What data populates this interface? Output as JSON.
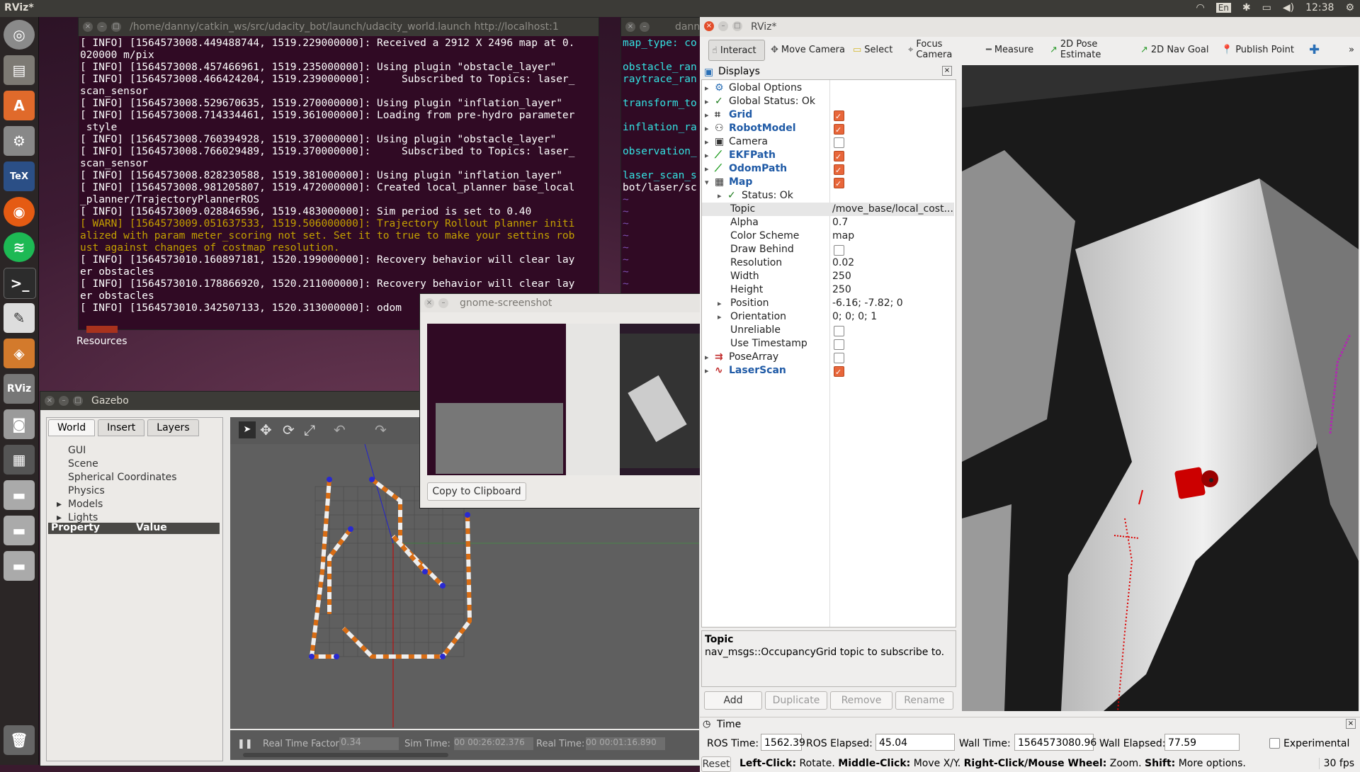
{
  "topbar": {
    "title": "RViz*",
    "keyboard": "En",
    "clock": "12:38"
  },
  "launcher": {
    "items": [
      "ubuntu-dash",
      "files",
      "software-center",
      "system-settings",
      "texmaker",
      "firefox",
      "spotify",
      "terminal",
      "text-editor",
      "virtualbox",
      "rviz",
      "screenshot",
      "workspaces",
      "drive-1",
      "drive-2",
      "drive-3",
      "trash"
    ]
  },
  "terminal1": {
    "title": "/home/danny/catkin_ws/src/udacity_bot/launch/udacity_world.launch http://localhost:1",
    "lines": [
      {
        "text": "[ INFO] [1564573008.449488744, 1519.229000000]: Received a 2912 X 2496 map at 0.",
        "cls": ""
      },
      {
        "text": "020000 m/pix",
        "cls": ""
      },
      {
        "text": "[ INFO] [1564573008.457466961, 1519.235000000]: Using plugin \"obstacle_layer\"",
        "cls": ""
      },
      {
        "text": "[ INFO] [1564573008.466424204, 1519.239000000]:     Subscribed to Topics: laser_",
        "cls": ""
      },
      {
        "text": "scan_sensor",
        "cls": ""
      },
      {
        "text": "[ INFO] [1564573008.529670635, 1519.270000000]: Using plugin \"inflation_layer\"",
        "cls": ""
      },
      {
        "text": "[ INFO] [1564573008.714334461, 1519.361000000]: Loading from pre-hydro parameter",
        "cls": ""
      },
      {
        "text": " style",
        "cls": ""
      },
      {
        "text": "[ INFO] [1564573008.760394928, 1519.370000000]: Using plugin \"obstacle_layer\"",
        "cls": ""
      },
      {
        "text": "[ INFO] [1564573008.766029489, 1519.370000000]:     Subscribed to Topics: laser_",
        "cls": ""
      },
      {
        "text": "scan_sensor",
        "cls": ""
      },
      {
        "text": "[ INFO] [1564573008.828230588, 1519.381000000]: Using plugin \"inflation_layer\"",
        "cls": ""
      },
      {
        "text": "[ INFO] [1564573008.981205807, 1519.472000000]: Created local_planner base_local",
        "cls": ""
      },
      {
        "text": "_planner/TrajectoryPlannerROS",
        "cls": ""
      },
      {
        "text": "[ INFO] [1564573009.028846596, 1519.483000000]: Sim period is set to 0.40",
        "cls": ""
      },
      {
        "text": "[ WARN] [1564573009.051637533, 1519.506000000]: Trajectory Rollout planner initi",
        "cls": "warn"
      },
      {
        "text": "alized with param meter_scoring not set. Set it to true to make your settins rob",
        "cls": "warn"
      },
      {
        "text": "ust against changes of costmap resolution.",
        "cls": "warn"
      },
      {
        "text": "[ INFO] [1564573010.160897181, 1520.199000000]: Recovery behavior will clear lay",
        "cls": ""
      },
      {
        "text": "er obstacles",
        "cls": ""
      },
      {
        "text": "[ INFO] [1564573010.178866920, 1520.211000000]: Recovery behavior will clear lay",
        "cls": ""
      },
      {
        "text": "er obstacles",
        "cls": ""
      },
      {
        "text": "[ INFO] [1564573010.342507133, 1520.313000000]: odom",
        "cls": ""
      }
    ]
  },
  "terminal2": {
    "title": "dann",
    "lines": [
      {
        "text": "map_type: co",
        "cls": "cyan"
      },
      {
        "text": "",
        "cls": ""
      },
      {
        "text": "obstacle_ran",
        "cls": "cyan"
      },
      {
        "text": "raytrace_ran",
        "cls": "cyan"
      },
      {
        "text": "",
        "cls": ""
      },
      {
        "text": "transform_to",
        "cls": "cyan"
      },
      {
        "text": "",
        "cls": ""
      },
      {
        "text": "inflation_ra",
        "cls": "cyan"
      },
      {
        "text": "",
        "cls": ""
      },
      {
        "text": "observation_",
        "cls": "cyan"
      },
      {
        "text": "",
        "cls": ""
      },
      {
        "text": "laser_scan_s",
        "cls": "cyan"
      },
      {
        "text": "bot/laser/sc",
        "cls": ""
      },
      {
        "text": "~",
        "cls": "purple"
      },
      {
        "text": "~",
        "cls": "purple"
      },
      {
        "text": "~",
        "cls": "purple"
      },
      {
        "text": "~",
        "cls": "purple"
      },
      {
        "text": "~",
        "cls": "purple"
      },
      {
        "text": "~",
        "cls": "purple"
      },
      {
        "text": "~",
        "cls": "purple"
      },
      {
        "text": "~",
        "cls": "purple"
      },
      {
        "text": "~",
        "cls": "purple"
      }
    ]
  },
  "desktop": {
    "resources_label": "Resources"
  },
  "screenshot_dialog": {
    "title": "gnome-screenshot",
    "copy_button": "Copy to Clipboard"
  },
  "gazebo": {
    "title": "Gazebo",
    "tabs": [
      "World",
      "Insert",
      "Layers"
    ],
    "tree": [
      {
        "label": "GUI",
        "expandable": false
      },
      {
        "label": "Scene",
        "expandable": false
      },
      {
        "label": "Spherical Coordinates",
        "expandable": false
      },
      {
        "label": "Physics",
        "expandable": false
      },
      {
        "label": "Models",
        "expandable": true
      },
      {
        "label": "Lights",
        "expandable": true
      }
    ],
    "prop_header": {
      "property": "Property",
      "value": "Value"
    },
    "status": {
      "rtf_label": "Real Time Factor:",
      "rtf": "0.34",
      "sim_label": "Sim Time:",
      "sim": "00 00:26:02.376",
      "real_label": "Real Time:",
      "real": "00 00:01:16.890"
    }
  },
  "rviz": {
    "title": "RViz*",
    "toolbar": [
      "Interact",
      "Move Camera",
      "Select",
      "Focus Camera",
      "Measure",
      "2D Pose Estimate",
      "2D Nav Goal",
      "Publish Point"
    ],
    "displays_title": "Displays",
    "tree": [
      {
        "label": "Global Options",
        "bold": false,
        "check": null,
        "expander": "▸",
        "indent": 0,
        "icon": "gear"
      },
      {
        "label": "Global Status: Ok",
        "bold": false,
        "check": null,
        "expander": "▸",
        "indent": 0,
        "icon": "tick"
      },
      {
        "label": "Grid",
        "bold": true,
        "check": true,
        "expander": "▸",
        "indent": 0,
        "icon": "grid"
      },
      {
        "label": "RobotModel",
        "bold": true,
        "check": true,
        "expander": "▸",
        "indent": 0,
        "icon": "robot"
      },
      {
        "label": "Camera",
        "bold": false,
        "check": false,
        "expander": "▸",
        "indent": 0,
        "icon": "camera"
      },
      {
        "label": "EKFPath",
        "bold": true,
        "check": true,
        "expander": "▸",
        "indent": 0,
        "icon": "path"
      },
      {
        "label": "OdomPath",
        "bold": true,
        "check": true,
        "expander": "▸",
        "indent": 0,
        "icon": "path"
      },
      {
        "label": "Map",
        "bold": true,
        "check": true,
        "expander": "▾",
        "indent": 0,
        "icon": "map"
      },
      {
        "label": "Status: Ok",
        "bold": false,
        "check": null,
        "expander": "▸",
        "indent": 1,
        "icon": "tick"
      },
      {
        "label": "Topic",
        "bold": false,
        "check": null,
        "expander": "",
        "indent": 1,
        "icon": "",
        "value": "/move_base/local_cost..."
      },
      {
        "label": "Alpha",
        "bold": false,
        "check": null,
        "expander": "",
        "indent": 1,
        "icon": "",
        "value": "0.7"
      },
      {
        "label": "Color Scheme",
        "bold": false,
        "check": null,
        "expander": "",
        "indent": 1,
        "icon": "",
        "value": "map"
      },
      {
        "label": "Draw Behind",
        "bold": false,
        "check": false,
        "expander": "",
        "indent": 1,
        "icon": ""
      },
      {
        "label": "Resolution",
        "bold": false,
        "check": null,
        "expander": "",
        "indent": 1,
        "icon": "",
        "value": "0.02"
      },
      {
        "label": "Width",
        "bold": false,
        "check": null,
        "expander": "",
        "indent": 1,
        "icon": "",
        "value": "250"
      },
      {
        "label": "Height",
        "bold": false,
        "check": null,
        "expander": "",
        "indent": 1,
        "icon": "",
        "value": "250"
      },
      {
        "label": "Position",
        "bold": false,
        "check": null,
        "expander": "▸",
        "indent": 1,
        "icon": "",
        "value": "-6.16; -7.82; 0"
      },
      {
        "label": "Orientation",
        "bold": false,
        "check": null,
        "expander": "▸",
        "indent": 1,
        "icon": "",
        "value": "0; 0; 0; 1"
      },
      {
        "label": "Unreliable",
        "bold": false,
        "check": false,
        "expander": "",
        "indent": 1,
        "icon": ""
      },
      {
        "label": "Use Timestamp",
        "bold": false,
        "check": false,
        "expander": "",
        "indent": 1,
        "icon": ""
      },
      {
        "label": "PoseArray",
        "bold": false,
        "check": false,
        "expander": "▸",
        "indent": 0,
        "icon": "pose"
      },
      {
        "label": "LaserScan",
        "bold": true,
        "check": true,
        "expander": "▸",
        "indent": 0,
        "icon": "laser"
      }
    ],
    "help_title": "Topic",
    "help_text": "nav_msgs::OccupancyGrid topic to subscribe to.",
    "buttons": {
      "add": "Add",
      "duplicate": "Duplicate",
      "remove": "Remove",
      "rename": "Rename"
    },
    "time": {
      "title": "Time",
      "ros_time_label": "ROS Time:",
      "ros_time": "1562.39",
      "ros_elapsed_label": "ROS Elapsed:",
      "ros_elapsed": "45.04",
      "wall_time_label": "Wall Time:",
      "wall_time": "1564573080.96",
      "wall_elapsed_label": "Wall Elapsed:",
      "wall_elapsed": "77.59",
      "experimental": "Experimental"
    },
    "status_bar": {
      "reset": "Reset",
      "hint_b1": "Left-Click:",
      "hint_t1": " Rotate. ",
      "hint_b2": "Middle-Click:",
      "hint_t2": " Move X/Y. ",
      "hint_b3": "Right-Click/Mouse Wheel:",
      "hint_t3": " Zoom. ",
      "hint_b4": "Shift:",
      "hint_t4": " More options.",
      "fps": "30 fps"
    }
  }
}
